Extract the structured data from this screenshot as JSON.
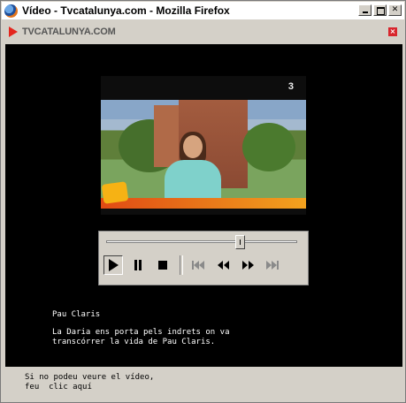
{
  "window": {
    "title": "Vídeo - Tvcatalunya.com - Mozilla Firefox",
    "controls": [
      "minimize",
      "maximize",
      "close"
    ]
  },
  "header": {
    "logo_text": "TVCATALUNYA.COM",
    "close_label": "×"
  },
  "video": {
    "channel_logo": "3",
    "progress_fraction": 0.7
  },
  "player_controls": [
    "play",
    "pause",
    "stop",
    "previous",
    "rewind",
    "fast-forward",
    "next"
  ],
  "clip": {
    "title": "Pau Claris",
    "description_line1": "La Daria ens porta pels indrets on va",
    "description_line2": "transcórrer la vida de Pau Claris."
  },
  "footer": {
    "line1": "Si no podeu veure el vídeo,",
    "line2": "feu  clic aquí"
  },
  "colors": {
    "accent": "#e4261e",
    "background": "#000000",
    "chrome": "#d4d0c8"
  }
}
